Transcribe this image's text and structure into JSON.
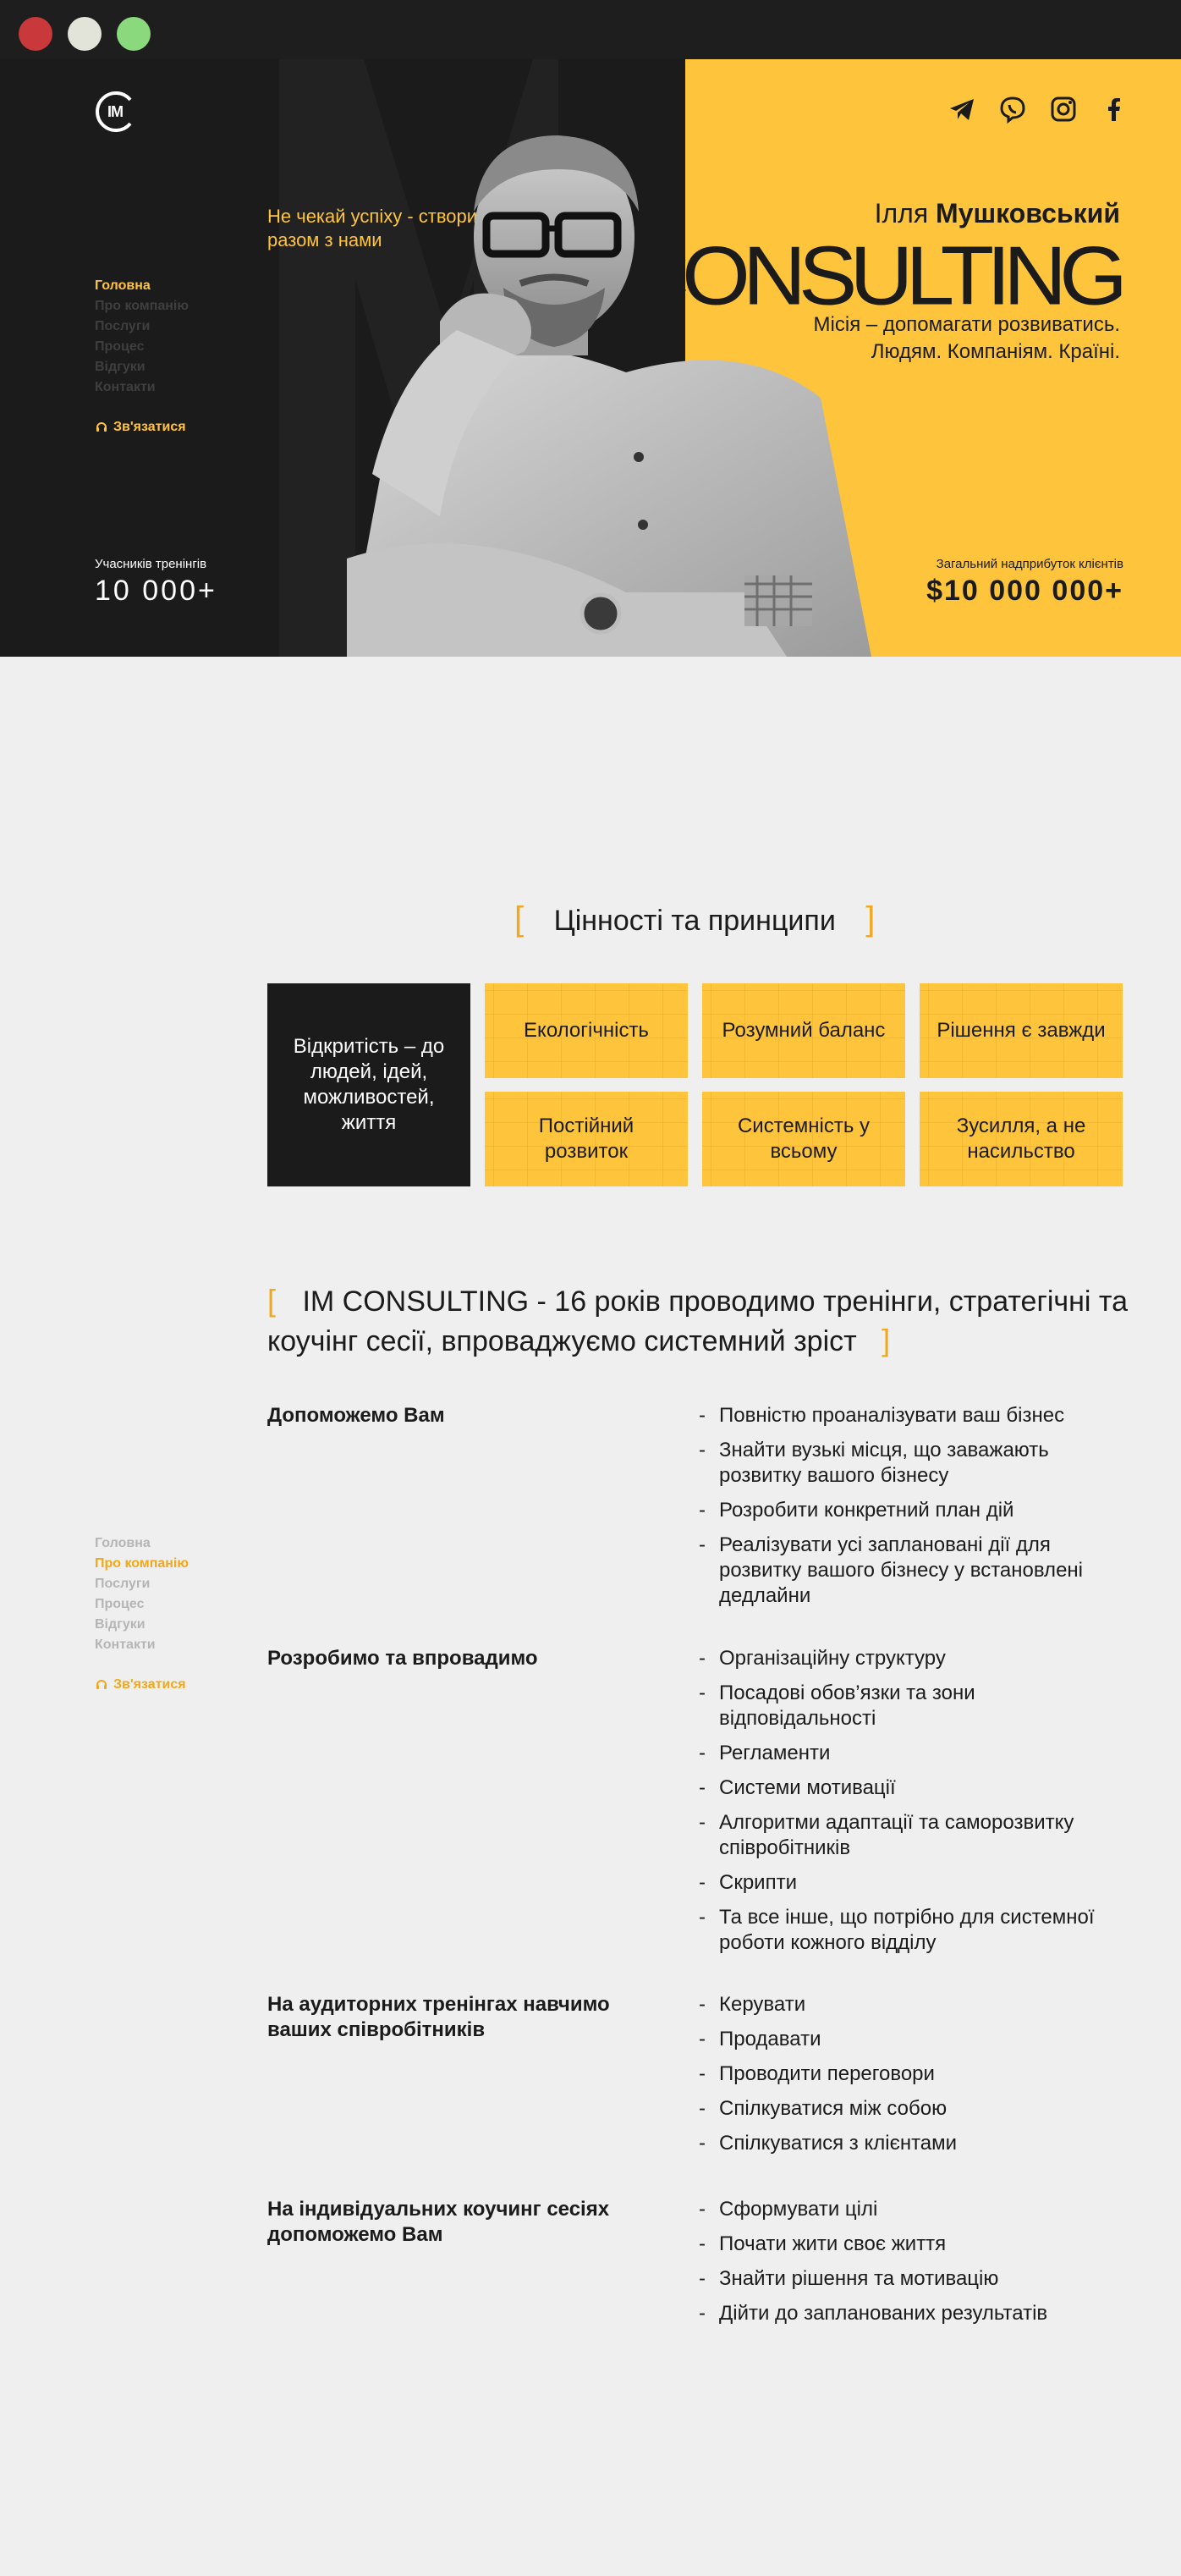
{
  "window": {
    "controls": [
      "close",
      "minimize",
      "maximize"
    ]
  },
  "logo": {
    "text": "IM"
  },
  "nav": {
    "items": [
      {
        "label": "Головна"
      },
      {
        "label": "Про компанію"
      },
      {
        "label": "Послуги"
      },
      {
        "label": "Процес"
      },
      {
        "label": "Відгуки"
      },
      {
        "label": "Контакти"
      }
    ],
    "contact_label": "Зв'язатися"
  },
  "hero": {
    "tagline": "Не чекай успіху - створи його разом з нами",
    "first_name": "Ілля",
    "last_name": "Мушковський",
    "brand": "CONSULTING",
    "mission_line1": "Місія – допомагати розвиватись.",
    "mission_line2": "Людям. Компаніям. Країні.",
    "socials": [
      "telegram-icon",
      "viber-icon",
      "instagram-icon",
      "facebook-icon"
    ],
    "stat_left": {
      "label": "Учасників тренінгів",
      "value": "10 000+"
    },
    "stat_right": {
      "label": "Загальний надприбуток клієнтів",
      "value": "$10 000 000+"
    }
  },
  "values": {
    "title": "Цінності та принципи",
    "bracket_open": "[",
    "bracket_close": "]",
    "main": "Відкритість – до людей, ідей, можливостей, життя",
    "items": [
      "Екологічність",
      "Розумний баланс",
      "Рішення є завжди",
      "Постійний розвиток",
      "Системність у всьому",
      "Зусилля, а не насильство"
    ]
  },
  "about": {
    "title": "IM CONSULTING - 16 років проводимо тренінги, стратегічні та коучінг сесії, впроваджуємо системний зріст",
    "blocks": [
      {
        "title": "Допоможемо Вам",
        "items": [
          "Повністю проаналізувати ваш бізнес",
          "Знайти вузькі місця, що заважають розвитку вашого бізнесу",
          "Розробити конкретний план дій",
          "Реалізувати усі заплановані дії для розвитку вашого бізнесу у встановлені дедлайни"
        ]
      },
      {
        "title": "Розробимо та впровадимо",
        "items": [
          "Організаційну структуру",
          "Посадові обов’язки та зони відповідальності",
          "Регламенти",
          "Системи мотивації",
          "Алгоритми адаптації та саморозвитку співробітників",
          "Скрипти",
          "Та все інше, що потрібно для системної роботи кожного відділу"
        ]
      },
      {
        "title": "На аудиторних тренінгах навчимо ваших співробітників",
        "items": [
          "Керувати",
          "Продавати",
          "Проводити переговори",
          "Спілкуватися між собою",
          "Спілкуватися з клієнтами"
        ]
      },
      {
        "title": "На індивідуальних коучинг сесіях допоможемо Вам",
        "items": [
          "Сформувати цілі",
          "Почати жити своє життя",
          "Знайти рішення та мотивацію",
          "Дійти до запланованих результатів"
        ]
      }
    ]
  },
  "colors": {
    "accent": "#fec43c",
    "accent_dark": "#f0a81c",
    "dark": "#1b1b1b",
    "page_bg": "#efefef"
  }
}
